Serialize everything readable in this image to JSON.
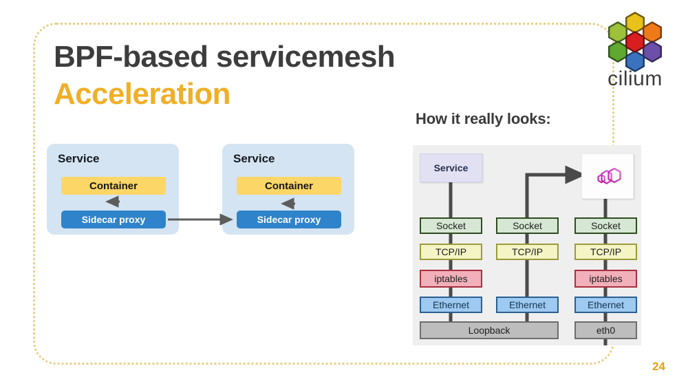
{
  "slide": {
    "title_line1": "BPF-based servicemesh",
    "title_line2": "Acceleration",
    "page_number": "24",
    "accent_gold": "#efaf28",
    "title_dark": "#3d3d3d",
    "border_color": "#e8cf86"
  },
  "logo": {
    "wordmark": "cilium",
    "hex_colors": {
      "center": "#d81e1e",
      "top": "#e8c11a",
      "top_right": "#ef7b18",
      "bottom_right": "#6b4fa8",
      "bottom": "#3a72c0",
      "bottom_left": "#61a830",
      "top_left": "#9ec13a"
    }
  },
  "left_diagram": {
    "services": [
      {
        "label": "Service",
        "container_label": "Container",
        "sidecar_label": "Sidecar proxy",
        "internal_arrow": "down"
      },
      {
        "label": "Service",
        "container_label": "Container",
        "sidecar_label": "Sidecar proxy",
        "internal_arrow": "up"
      }
    ],
    "link_arrow": "sidecar-to-sidecar",
    "colors": {
      "panel": "#d4e4f2",
      "container": "#fcd667",
      "sidecar": "#2f83ca",
      "arrow": "#5c5c5c"
    }
  },
  "right_section": {
    "heading": "How it really looks:",
    "nodes": {
      "service": "Service",
      "envoy_icon": "envoy-hexagon-logo"
    },
    "columns": [
      {
        "top": "Service",
        "layers": [
          "Socket",
          "TCP/IP",
          "iptables",
          "Ethernet"
        ]
      },
      {
        "top": "",
        "layers": [
          "Socket",
          "TCP/IP",
          "",
          "Ethernet"
        ]
      },
      {
        "top": "envoy",
        "layers": [
          "Socket",
          "TCP/IP",
          "iptables",
          "Ethernet"
        ]
      }
    ],
    "devices": {
      "loopback": "Loopback",
      "eth0": "eth0"
    },
    "labels": {
      "socket": "Socket",
      "tcpip": "TCP/IP",
      "iptables": "iptables",
      "ethernet": "Ethernet"
    },
    "colors": {
      "panel_bg": "#efeff0",
      "service": "#e2e1f4",
      "socket": "#d6e8d3",
      "tcpip": "#f4f4c5",
      "iptables": "#f1b0ba",
      "ethernet": "#9ec9f0",
      "device": "#bdbdbd",
      "wire": "#4a4a4a",
      "envoy_magenta": "#cc3fc0"
    }
  }
}
